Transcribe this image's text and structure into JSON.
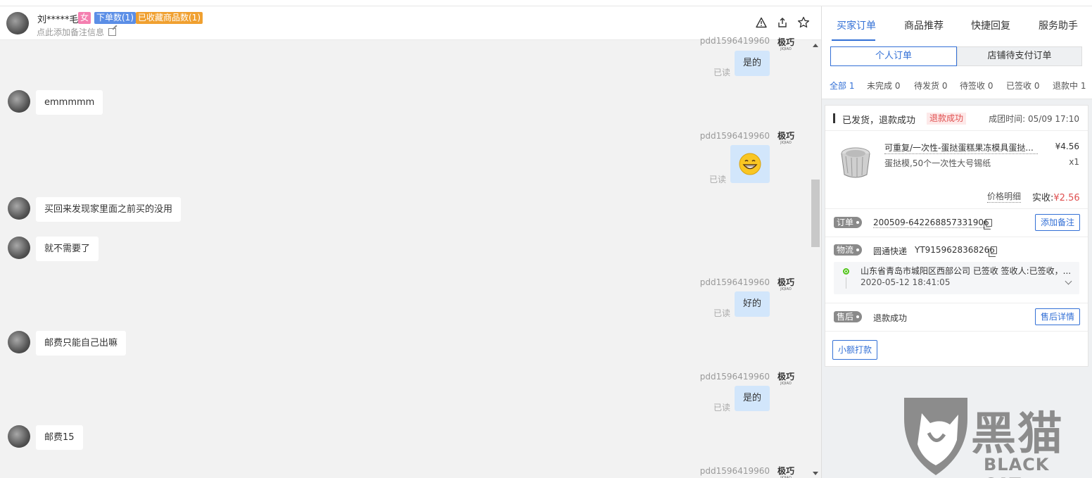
{
  "header": {
    "customer_name": "刘*****毛",
    "tag_gender": "女",
    "tag_orders": "下单数(1)",
    "tag_favorites": "已收藏商品数(1)",
    "note_placeholder": "点此添加备注信息",
    "icons": [
      "warning-icon",
      "share-icon",
      "star-icon"
    ]
  },
  "chat": {
    "shop_name": "pdd1596419960",
    "shop_logo_text": "极巧",
    "shop_logo_sub": "JIQIAO",
    "read_label": "已读",
    "messages": [
      {
        "from": "shop",
        "text": "是的"
      },
      {
        "from": "customer",
        "text": "emmmmm"
      },
      {
        "from": "shop",
        "text": "😁",
        "emoji": true
      },
      {
        "from": "customer",
        "text": "买回来发现家里面之前买的没用"
      },
      {
        "from": "customer",
        "text": "就不需要了"
      },
      {
        "from": "shop",
        "text": "好的"
      },
      {
        "from": "customer",
        "text": "邮费只能自己出嘛"
      },
      {
        "from": "shop",
        "text": "是的"
      },
      {
        "from": "customer",
        "text": "邮费15"
      },
      {
        "from": "shop",
        "text": ""
      }
    ]
  },
  "panel": {
    "tabs": [
      "买家订单",
      "商品推荐",
      "快捷回复",
      "服务助手"
    ],
    "active_tab": 0,
    "subtabs": [
      "个人订单",
      "店铺待支付订单"
    ],
    "filters": [
      "全部 1",
      "未完成 0",
      "待发货 0",
      "待签收 0",
      "已签收 0",
      "退款中 1"
    ],
    "order": {
      "status": "已发货，退款成功",
      "refund_badge": "退款成功",
      "group_time": "成团时间: 05/09 17:10",
      "product_name": "可重复/一次性-蛋挞蛋糕果冻模具蛋挞...",
      "product_price": "¥4.56",
      "product_spec": "蛋挞模,50个一次性大号锡纸",
      "product_qty": "x1",
      "price_detail": "价格明细",
      "paid_label": "实收:",
      "paid_amount": "¥2.56",
      "order_tag": "订单",
      "order_no": "200509-642268857331906",
      "add_note_button": "添加备注",
      "logistics_tag": "物流",
      "courier": "圆通快递",
      "tracking_no": "YT9159628368266",
      "logistics_status": "山东省青岛市城阳区西部公司 已签收 签收人:已签收，...",
      "logistics_time": "2020-05-12 18:41:05",
      "aftersale_tag": "售后",
      "aftersale_status": "退款成功",
      "aftersale_button": "售后详情",
      "small_pay_button": "小额打款"
    }
  },
  "watermark": {
    "text": "黑猫",
    "sub": "BLACK CAT"
  },
  "colors": {
    "accent": "#3370d6",
    "refund_red": "#e05050",
    "bubble_out": "#d2e6fb",
    "chat_bg": "#f2f2f2"
  }
}
